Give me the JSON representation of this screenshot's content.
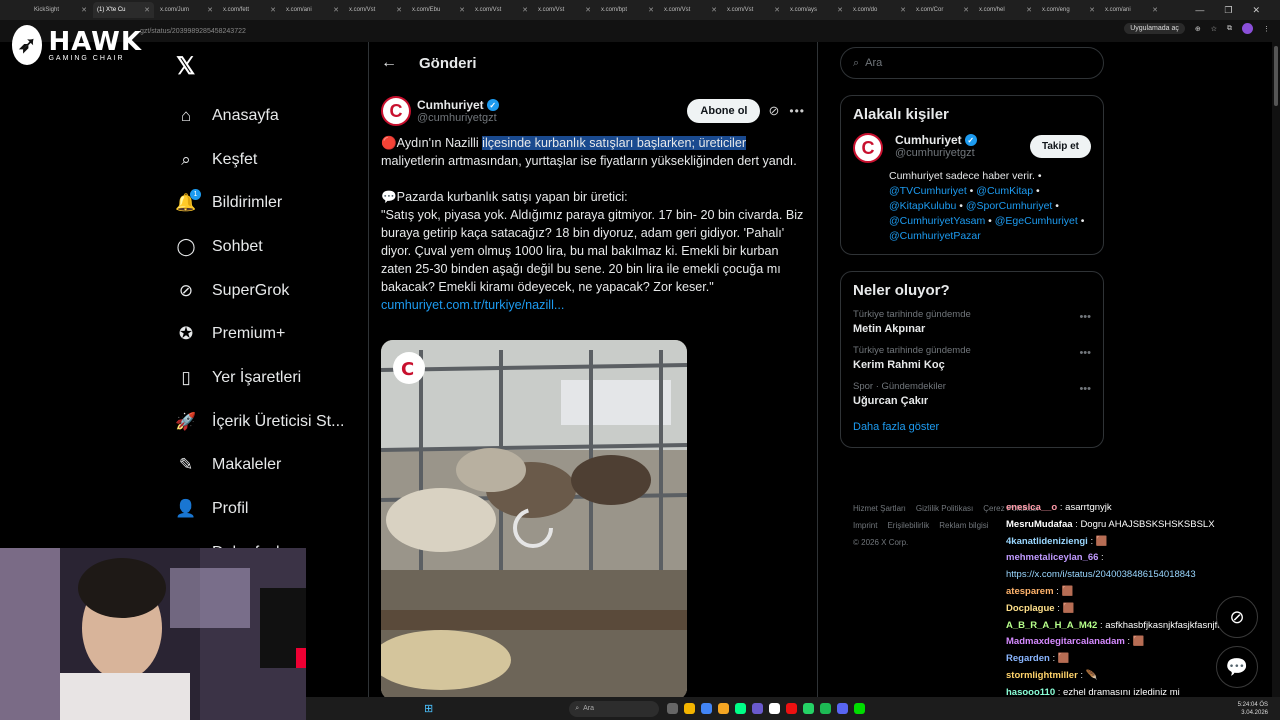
{
  "browser": {
    "tabs": [
      "KickSight",
      "(1) X'te Cu",
      "x.com/Jum",
      "x.com/fett",
      "x.com/ani",
      "x.com/Vst",
      "x.com/Ebu",
      "x.com/Vst",
      "x.com/Vst",
      "x.com/bpt",
      "x.com/Vst",
      "x.com/Vst",
      "x.com/ays",
      "x.com/do",
      "x.com/Cor",
      "x.com/hel",
      "x.com/eng",
      "x.com/ani"
    ],
    "url": "gzt/status/2039989285458243722",
    "app_chip": "Uygulamada aç"
  },
  "overlay": {
    "brand": "HAWK",
    "brand_sub": "GAMING CHAIR"
  },
  "nav": {
    "items": [
      {
        "label": "Anasayfa",
        "icon": "home-icon"
      },
      {
        "label": "Keşfet",
        "icon": "search-icon"
      },
      {
        "label": "Bildirimler",
        "icon": "bell-icon",
        "badge": "1"
      },
      {
        "label": "Sohbet",
        "icon": "chat-icon"
      },
      {
        "label": "SuperGrok",
        "icon": "grok-icon"
      },
      {
        "label": "Premium+",
        "icon": "premium-icon"
      },
      {
        "label": "Yer İşaretleri",
        "icon": "bookmark-icon"
      },
      {
        "label": "İçerik Üreticisi St...",
        "icon": "rocket-icon"
      },
      {
        "label": "Makaleler",
        "icon": "article-icon"
      },
      {
        "label": "Profil",
        "icon": "user-icon"
      },
      {
        "label": "Daha fazla",
        "icon": "more-icon"
      }
    ]
  },
  "main": {
    "title": "Gönderi",
    "post": {
      "author": "Cumhuriyet",
      "handle": "@cumhuriyetgzt",
      "subscribe": "Abone ol",
      "text_pre": "🔴Aydın'ın Nazilli ",
      "text_highlight": "ilçesinde kurbanlık satışları başlarken; üreticiler",
      "text_post": " maliyetlerin artmasından, yurttaşlar ise fiyatların yüksekliğinden dert yandı.\n\n💬Pazarda kurbanlık satışı yapan bir üretici:\n\"Satış yok, piyasa yok. Aldığımız paraya gitmiyor. 17 bin- 20 bin civarda. Biz buraya getirip kaça satacağız? 18 bin diyoruz, adam geri gidiyor. 'Pahalı' diyor. Çuval yem olmuş 1000 lira, bu mal bakılmaz ki. Emekli bir kurban zaten 25-30 binden aşağı değil bu sene. 20 bin lira ile emekli çocuğa mı bakacak? Emekli kiramı ödeyecek, ne yapacak? Zor keser.\"\n",
      "link": "cumhuriyet.com.tr/turkiye/nazill..."
    }
  },
  "right": {
    "search_placeholder": "Ara",
    "related_title": "Alakalı kişiler",
    "person": {
      "name": "Cumhuriyet",
      "handle": "@cumhuriyetgzt",
      "follow": "Takip et",
      "bio_text": "Cumhuriyet sadece haber verir. •",
      "bio_links": [
        "@TVCumhuriyet",
        "@CumKitap",
        "@KitapKulubu",
        "@SporCumhuriyet",
        "@CumhuriyetYasam",
        "@EgeCumhuriyet",
        "@CumhuriyetPazar"
      ]
    },
    "trends_title": "Neler oluyor?",
    "trends": [
      {
        "meta": "Türkiye tarihinde gündemde",
        "name": "Metin Akpınar"
      },
      {
        "meta": "Türkiye tarihinde gündemde",
        "name": "Kerim Rahmi Koç"
      },
      {
        "meta": "Spor · Gündemdekiler",
        "name": "Uğurcan Çakır"
      }
    ],
    "show_more": "Daha fazla göster",
    "footer": [
      "Hizmet Şartları",
      "Gizlilik Politikası",
      "Çerez Politikası",
      "Imprint",
      "Erişilebilirlik",
      "Reklam bilgisi",
      "© 2026 X Corp."
    ]
  },
  "chat": [
    {
      "user": "eneslca__o",
      "msg": "asarrtgnyjk",
      "color": "#ff9aa8"
    },
    {
      "user": "MesruMudafaa",
      "msg": "Dogru AHAJSBSKSHSKSBSLX",
      "color": "#ffffff"
    },
    {
      "user": "4kanatlideniziengi",
      "msg": "🟫",
      "color": "#9ad7ff"
    },
    {
      "user": "mehmetaliceylan_66",
      "msg": "https://x.com/i/status/2040038486154018843",
      "color": "#c09aff"
    },
    {
      "user": "atesparem",
      "msg": "🟫",
      "color": "#ffb36b"
    },
    {
      "user": "Docplague",
      "msg": "🟫",
      "color": "#ffe08a"
    },
    {
      "user": "A_B_R_A_H_A_M42",
      "msg": "asfkhasbfjkasnjkfasjkfasnjfk",
      "color": "#b6ff8a"
    },
    {
      "user": "Madmaxdegitarcalanadam",
      "msg": "🟫",
      "color": "#d58aff"
    },
    {
      "user": "Regarden",
      "msg": "🟫",
      "color": "#8ab6ff"
    },
    {
      "user": "stormlightmiller",
      "msg": "🪶",
      "color": "#ffd36b"
    },
    {
      "user": "hasooo110",
      "msg": "ezhel dramasını izlediniz mi",
      "color": "#8affd8"
    }
  ],
  "taskbar": {
    "search": "Ara",
    "time": "5:24:04 ÖS",
    "date": "3.04.2026"
  },
  "colors": {
    "accent": "#1d9bf0",
    "brand_red": "#c8102e",
    "highlight": "#1a4a8f"
  }
}
